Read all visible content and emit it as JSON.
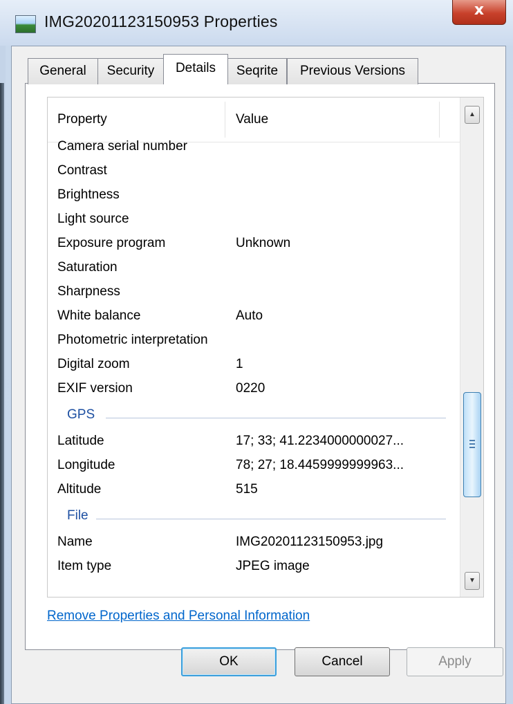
{
  "window": {
    "title": "IMG20201123150953 Properties",
    "close_label": "x"
  },
  "tabs": [
    {
      "label": "General"
    },
    {
      "label": "Security"
    },
    {
      "label": "Details",
      "active": true
    },
    {
      "label": "Seqrite"
    },
    {
      "label": "Previous Versions"
    }
  ],
  "list": {
    "header": {
      "property": "Property",
      "value": "Value"
    },
    "rows": [
      {
        "k": "Camera serial number",
        "v": ""
      },
      {
        "k": "Contrast",
        "v": ""
      },
      {
        "k": "Brightness",
        "v": ""
      },
      {
        "k": "Light source",
        "v": ""
      },
      {
        "k": "Exposure program",
        "v": "Unknown"
      },
      {
        "k": "Saturation",
        "v": ""
      },
      {
        "k": "Sharpness",
        "v": ""
      },
      {
        "k": "White balance",
        "v": "Auto"
      },
      {
        "k": "Photometric interpretation",
        "v": ""
      },
      {
        "k": "Digital zoom",
        "v": "1"
      },
      {
        "k": "EXIF version",
        "v": "0220"
      }
    ],
    "gps_group": "GPS",
    "gps_rows": [
      {
        "k": "Latitude",
        "v": "17; 33; 41.2234000000027..."
      },
      {
        "k": "Longitude",
        "v": "78; 27; 18.4459999999963..."
      },
      {
        "k": "Altitude",
        "v": "515"
      }
    ],
    "file_group": "File",
    "file_rows": [
      {
        "k": "Name",
        "v": "IMG20201123150953.jpg"
      },
      {
        "k": "Item type",
        "v": "JPEG image"
      }
    ],
    "scroll_position": 0.72
  },
  "link": "Remove Properties and Personal Information",
  "buttons": {
    "ok": "OK",
    "cancel": "Cancel",
    "apply": "Apply"
  },
  "colors": {
    "group_heading": "#1e50a2",
    "link": "#0066cc",
    "close_button": "#c8412b"
  }
}
